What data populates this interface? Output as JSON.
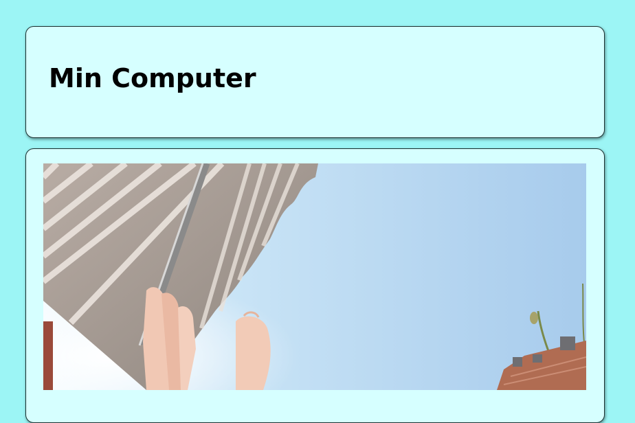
{
  "header": {
    "title": "Min Computer"
  },
  "photo": {
    "subject": "photo-image"
  },
  "colors": {
    "page_background": "#9cf5f5",
    "card_background": "#d6ffff",
    "card_border": "#1a2f2f"
  }
}
